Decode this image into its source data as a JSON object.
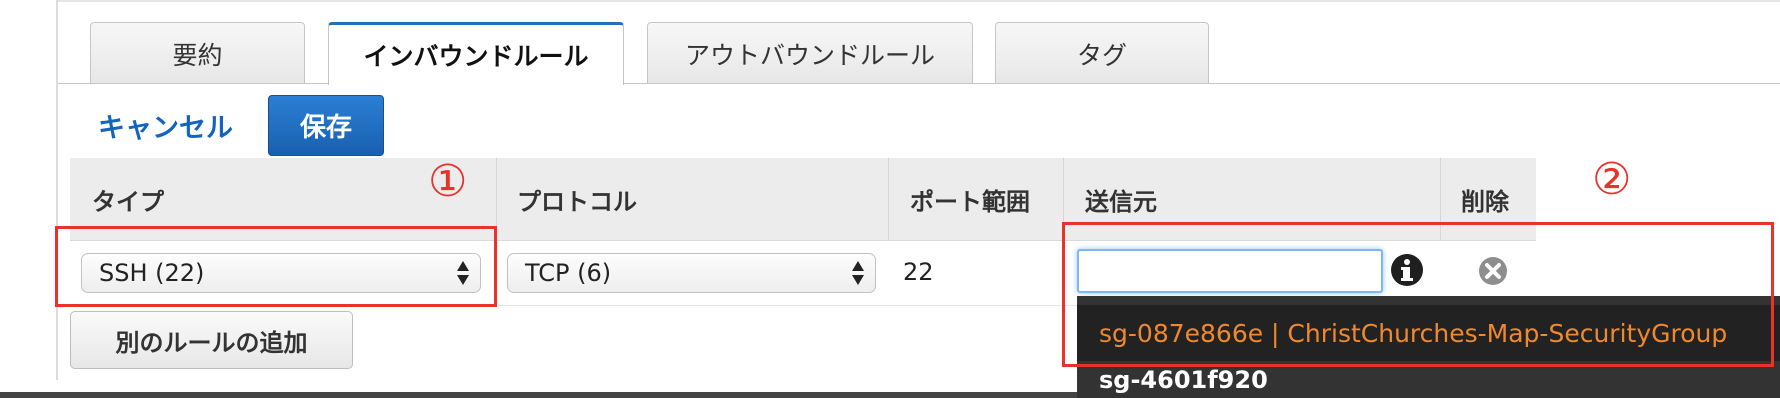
{
  "tabs": [
    {
      "label": "要約"
    },
    {
      "label": "インバウンドルール"
    },
    {
      "label": "アウトバウンドルール"
    },
    {
      "label": "タグ"
    }
  ],
  "actions": {
    "cancel_label": "キャンセル",
    "save_label": "保存"
  },
  "table": {
    "headers": {
      "type": "タイプ",
      "protocol": "プロトコル",
      "port": "ポート範囲",
      "source": "送信元",
      "delete": "削除"
    },
    "row": {
      "type": "SSH (22)",
      "protocol": "TCP (6)",
      "port": "22",
      "source_value": ""
    }
  },
  "add_rule_label": "別のルールの追加",
  "dropdown": {
    "items": [
      "sg-087e866e | ChristChurches-Map-SecurityGroup",
      "sg-4601f920"
    ]
  },
  "annotations": {
    "one": "①",
    "two": "②"
  },
  "colors": {
    "accent": "#1a6ac4",
    "annotation": "#e8322a",
    "dropdown_bg": "#222222",
    "dropdown_highlight": "#f0892e"
  },
  "icons": {
    "info": "info-icon",
    "delete": "delete-icon",
    "select_arrows": "select-arrows-icon"
  }
}
